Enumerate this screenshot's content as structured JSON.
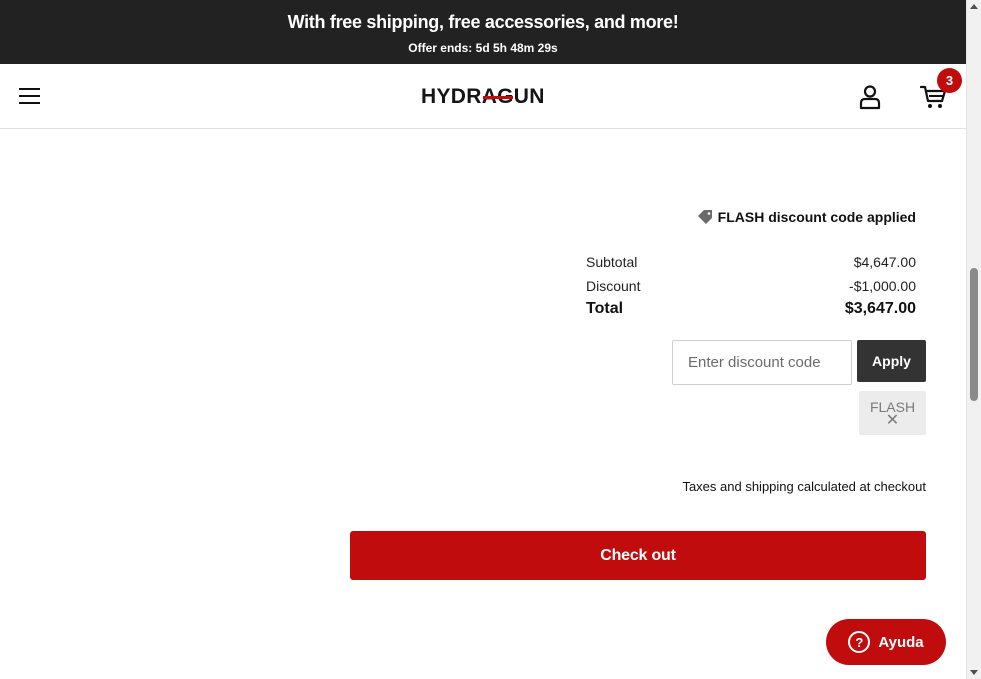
{
  "announcement": {
    "headline": "With free shipping, free accessories, and more!",
    "offer_ends": "Offer ends: 5d 5h 48m 29s"
  },
  "header": {
    "logo_text": "HYDRAGUN",
    "cart_count": "3"
  },
  "summary": {
    "discount_applied": "FLASH discount code applied",
    "subtotal_label": "Subtotal",
    "subtotal_value": "$4,647.00",
    "discount_label": "Discount",
    "discount_value": "-$1,000.00",
    "total_label": "Total",
    "total_value": "$3,647.00"
  },
  "discount_form": {
    "placeholder": "Enter discount code",
    "apply_label": "Apply",
    "applied_code": "FLASH",
    "remove_glyph": "✕"
  },
  "tax_note": "Taxes and shipping calculated at checkout",
  "checkout_label": "Check out",
  "help": {
    "label": "Ayuda",
    "icon_glyph": "?"
  },
  "colors": {
    "brand_red": "#c00c0c",
    "announcement_bg": "#222222",
    "apply_bg": "#333333"
  }
}
